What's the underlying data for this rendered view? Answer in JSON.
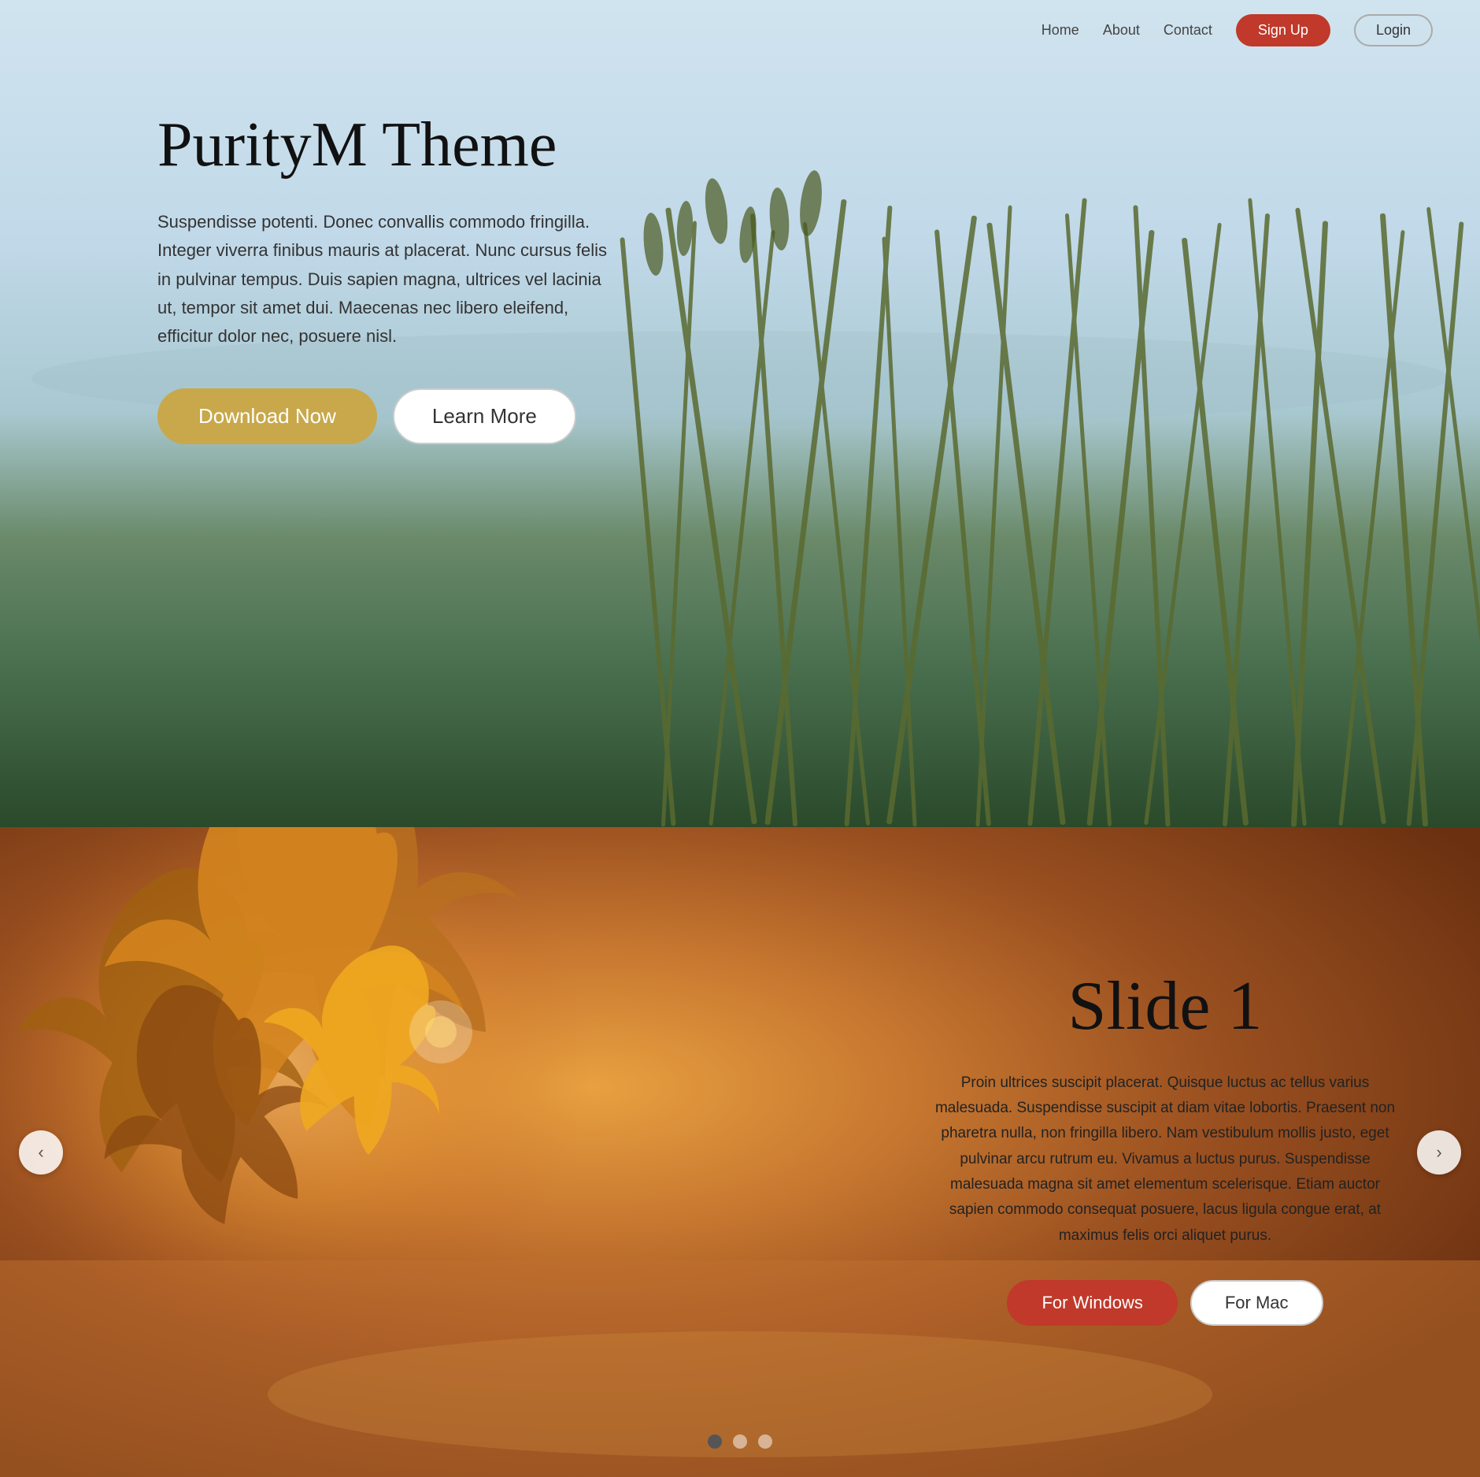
{
  "nav": {
    "links": [
      {
        "label": "Home",
        "name": "home"
      },
      {
        "label": "About",
        "name": "about"
      },
      {
        "label": "Contact",
        "name": "contact"
      }
    ],
    "signup_label": "Sign Up",
    "login_label": "Login"
  },
  "hero": {
    "title": "PurityM Theme",
    "description": "Suspendisse potenti. Donec convallis commodo fringilla. Integer viverra finibus mauris at placerat. Nunc cursus felis in pulvinar tempus. Duis sapien magna, ultrices vel lacinia ut, tempor sit amet dui. Maecenas nec libero eleifend, efficitur dolor nec, posuere nisl.",
    "download_label": "Download Now",
    "learn_label": "Learn More"
  },
  "slide": {
    "title": "Slide 1",
    "description": "Proin ultrices suscipit placerat. Quisque luctus ac tellus varius malesuada. Suspendisse suscipit at diam vitae lobortis. Praesent non pharetra nulla, non fringilla libero. Nam vestibulum mollis justo, eget pulvinar arcu rutrum eu. Vivamus a luctus purus. Suspendisse malesuada magna sit amet elementum scelerisque. Etiam auctor sapien commodo consequat posuere, lacus ligula congue erat, at maximus felis orci aliquet purus.",
    "windows_label": "For Windows",
    "mac_label": "For Mac",
    "dots": [
      {
        "active": true
      },
      {
        "active": false
      },
      {
        "active": false
      }
    ],
    "prev_arrow": "‹",
    "next_arrow": "›"
  }
}
